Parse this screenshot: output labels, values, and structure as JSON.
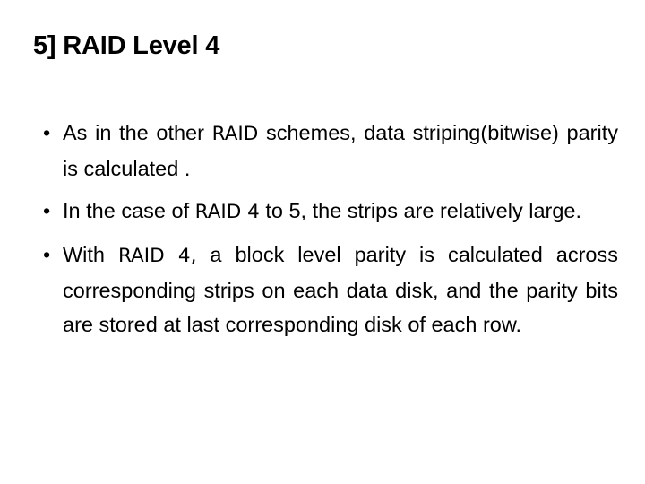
{
  "slide": {
    "title": "5] RAID Level 4",
    "background_color": "#ffffff",
    "text_color": "#000000",
    "bullet_glyph": "•",
    "bullets": [
      {
        "id": "bullet-1",
        "segments": [
          {
            "text": "As in the other ",
            "face": "normal"
          },
          {
            "text": "RAID",
            "face": "alt"
          },
          {
            "text": " schemes, data striping(bitwise) parity is calculated .",
            "face": "normal"
          }
        ],
        "plain_text": "As in the other RAID schemes, data striping(bitwise) parity is calculated ."
      },
      {
        "id": "bullet-2",
        "segments": [
          {
            "text": "In the case of ",
            "face": "normal"
          },
          {
            "text": "RAID 4",
            "face": "alt"
          },
          {
            "text": " to 5, the strips are relatively large.",
            "face": "normal"
          }
        ],
        "plain_text": "In the case of RAID 4 to 5, the strips are relatively large."
      },
      {
        "id": "bullet-3",
        "segments": [
          {
            "text": "With ",
            "face": "normal"
          },
          {
            "text": "RAID 4,",
            "face": "alt"
          },
          {
            "text": " a block level parity is calculated across corresponding strips on each data disk, and the parity bits are stored at last corresponding disk of each row.",
            "face": "normal"
          }
        ],
        "plain_text": "With RAID 4, a block level parity is calculated across corresponding strips on each data disk, and the parity bits are stored at last corresponding disk of each row."
      }
    ]
  }
}
